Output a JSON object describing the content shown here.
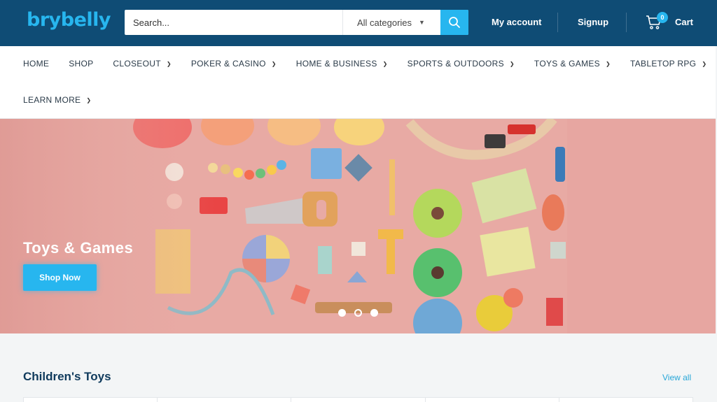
{
  "header": {
    "logo": "brybelly",
    "search": {
      "placeholder": "Search...",
      "category": "All categories"
    },
    "links": {
      "account": "My account",
      "signup": "Signup",
      "cart": "Cart"
    },
    "cart_count": "0"
  },
  "nav": {
    "items": [
      {
        "label": "HOME",
        "dropdown": false
      },
      {
        "label": "SHOP",
        "dropdown": false
      },
      {
        "label": "CLOSEOUT",
        "dropdown": true
      },
      {
        "label": "POKER & CASINO",
        "dropdown": true
      },
      {
        "label": "HOME & BUSINESS",
        "dropdown": true
      },
      {
        "label": "SPORTS & OUTDOORS",
        "dropdown": true
      },
      {
        "label": "TOYS & GAMES",
        "dropdown": true
      },
      {
        "label": "TABLETOP RPG",
        "dropdown": true
      },
      {
        "label": "LEARN MORE",
        "dropdown": true
      }
    ]
  },
  "hero": {
    "title": "Toys & Games",
    "button": "Shop Now",
    "slides": 3,
    "active_slide": 2
  },
  "section": {
    "title": "Children's Toys",
    "view_all": "View all"
  },
  "colors": {
    "header_bg": "#0f4c75",
    "accent": "#27b6ef",
    "hero_bg": "#e6a9a4"
  }
}
